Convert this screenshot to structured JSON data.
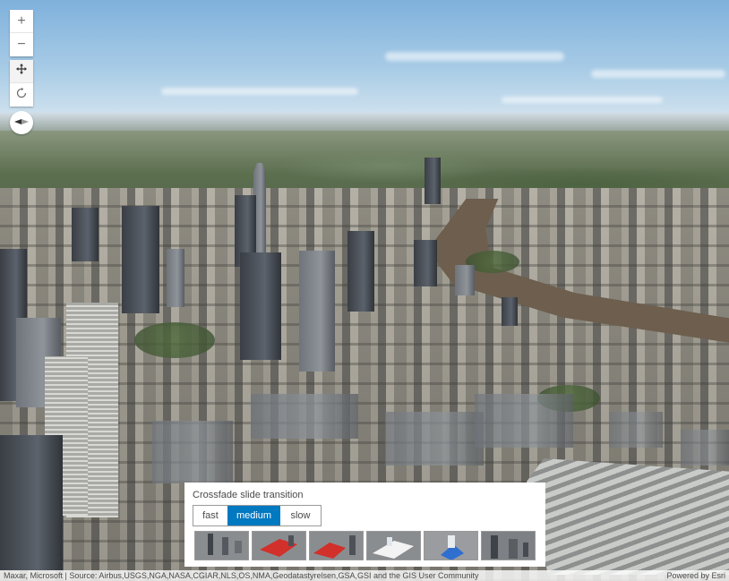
{
  "map": {
    "attribution": "Maxar, Microsoft | Source: Airbus,USGS,NGA,NASA,CGIAR,NLS,OS,NMA,Geodatastyrelsen,GSA,GSI and the GIS User Community",
    "powered_by": "Powered by Esri"
  },
  "controls": {
    "zoom_in": "+",
    "zoom_out": "−",
    "icons": [
      "pan-icon",
      "rotate-icon",
      "compass-icon"
    ]
  },
  "slides_panel": {
    "title": "Crossfade slide transition",
    "speed_options": [
      "fast",
      "medium",
      "slow"
    ],
    "selected_speed": "medium",
    "accent_color": "#0079c1",
    "slide_count": 6
  }
}
